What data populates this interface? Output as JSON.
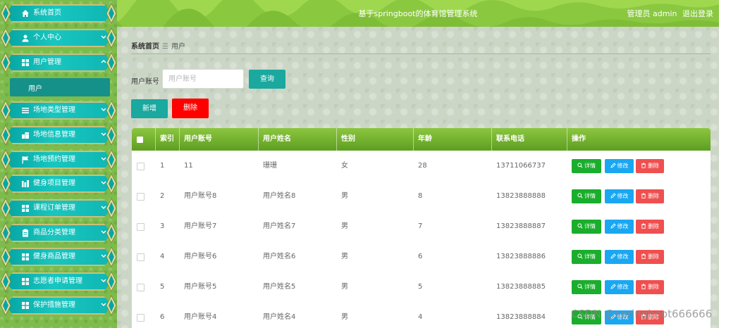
{
  "header": {
    "title": "基于springboot的体育馆管理系统",
    "user_label": "管理员 admin",
    "logout_label": "退出登录"
  },
  "sidebar": {
    "items": [
      {
        "label": "系统首页",
        "icon": "home-icon",
        "has_chevron": false
      },
      {
        "label": "个人中心",
        "icon": "person-icon",
        "has_chevron": true
      },
      {
        "label": "用户管理",
        "icon": "grid-icon",
        "has_chevron": true,
        "expanded": true
      },
      {
        "label": "场地类型管理",
        "icon": "list-icon",
        "has_chevron": true
      },
      {
        "label": "场地信息管理",
        "icon": "building-icon",
        "has_chevron": true
      },
      {
        "label": "场地预约管理",
        "icon": "flag-icon",
        "has_chevron": true
      },
      {
        "label": "健身项目管理",
        "icon": "bars-icon",
        "has_chevron": true
      },
      {
        "label": "课程订单管理",
        "icon": "grid-icon",
        "has_chevron": true
      },
      {
        "label": "商品分类管理",
        "icon": "clipboard-icon",
        "has_chevron": true
      },
      {
        "label": "健身商品管理",
        "icon": "grid-icon",
        "has_chevron": true
      },
      {
        "label": "志愿者申请管理",
        "icon": "grid-icon",
        "has_chevron": true
      },
      {
        "label": "保护措施管理",
        "icon": "grid-icon",
        "has_chevron": true
      }
    ],
    "sub_item": "用户"
  },
  "breadcrumb": {
    "home": "系统首页",
    "separator": "☰",
    "current": "用户"
  },
  "search": {
    "label": "用户账号",
    "placeholder": "用户账号",
    "query_button": "查询"
  },
  "actions": {
    "add": "新增",
    "delete": "删除"
  },
  "table": {
    "columns": [
      "索引",
      "用户账号",
      "用户姓名",
      "性别",
      "年龄",
      "联系电话",
      "操作"
    ],
    "rows": [
      {
        "index": "1",
        "account": "11",
        "name": "珊珊",
        "gender": "女",
        "age": "28",
        "phone": "13711066737"
      },
      {
        "index": "2",
        "account": "用户账号8",
        "name": "用户姓名8",
        "gender": "男",
        "age": "8",
        "phone": "13823888888"
      },
      {
        "index": "3",
        "account": "用户账号7",
        "name": "用户姓名7",
        "gender": "男",
        "age": "7",
        "phone": "13823888887"
      },
      {
        "index": "4",
        "account": "用户账号6",
        "name": "用户姓名6",
        "gender": "男",
        "age": "6",
        "phone": "13823888886"
      },
      {
        "index": "5",
        "account": "用户账号5",
        "name": "用户姓名5",
        "gender": "男",
        "age": "5",
        "phone": "13823888885"
      },
      {
        "index": "6",
        "account": "用户账号4",
        "name": "用户姓名4",
        "gender": "男",
        "age": "4",
        "phone": "13823888884"
      }
    ],
    "row_actions": {
      "detail": "详情",
      "edit": "修改",
      "delete": "删除"
    }
  },
  "watermark": "CSDN @springboot666666",
  "colors": {
    "header_green": "#8ac840",
    "table_head_green": "#6aab2a",
    "teal": "#1aa89f",
    "danger": "#ff0000"
  }
}
